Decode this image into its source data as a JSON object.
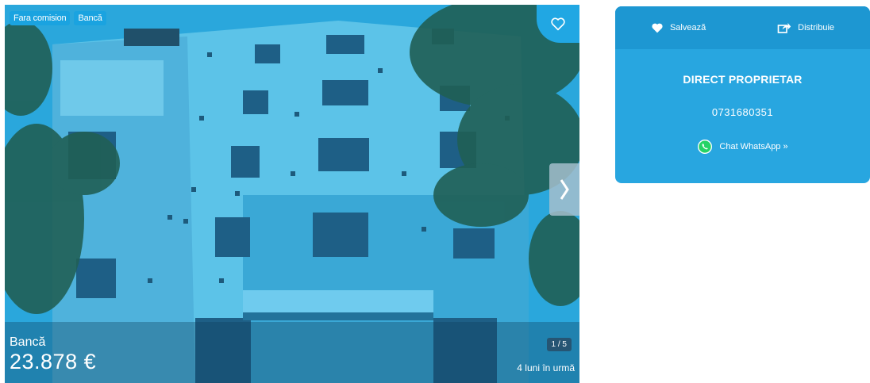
{
  "listing": {
    "tags": [
      "Fara comision",
      "Bancă"
    ],
    "price_type": "Bancă",
    "price": "23.878 €",
    "photo_counter": "1 / 5",
    "posted_ago": "4 luni în urmă"
  },
  "contact": {
    "save_label": "Salvează",
    "share_label": "Distribuie",
    "owner_type": "DIRECT PROPRIETAR",
    "phone": "0731680351",
    "whatsapp_label": "Chat WhatsApp »"
  },
  "colors": {
    "accent": "#28a6e0",
    "accent_dark": "#1d97d2",
    "tag": "#1aa3e0",
    "whatsapp": "#25d366"
  },
  "icons": {
    "save": "heart-icon",
    "share": "share-icon",
    "favorite": "heart-outline-icon",
    "next": "chevron-right-icon",
    "chat": "whatsapp-icon"
  }
}
